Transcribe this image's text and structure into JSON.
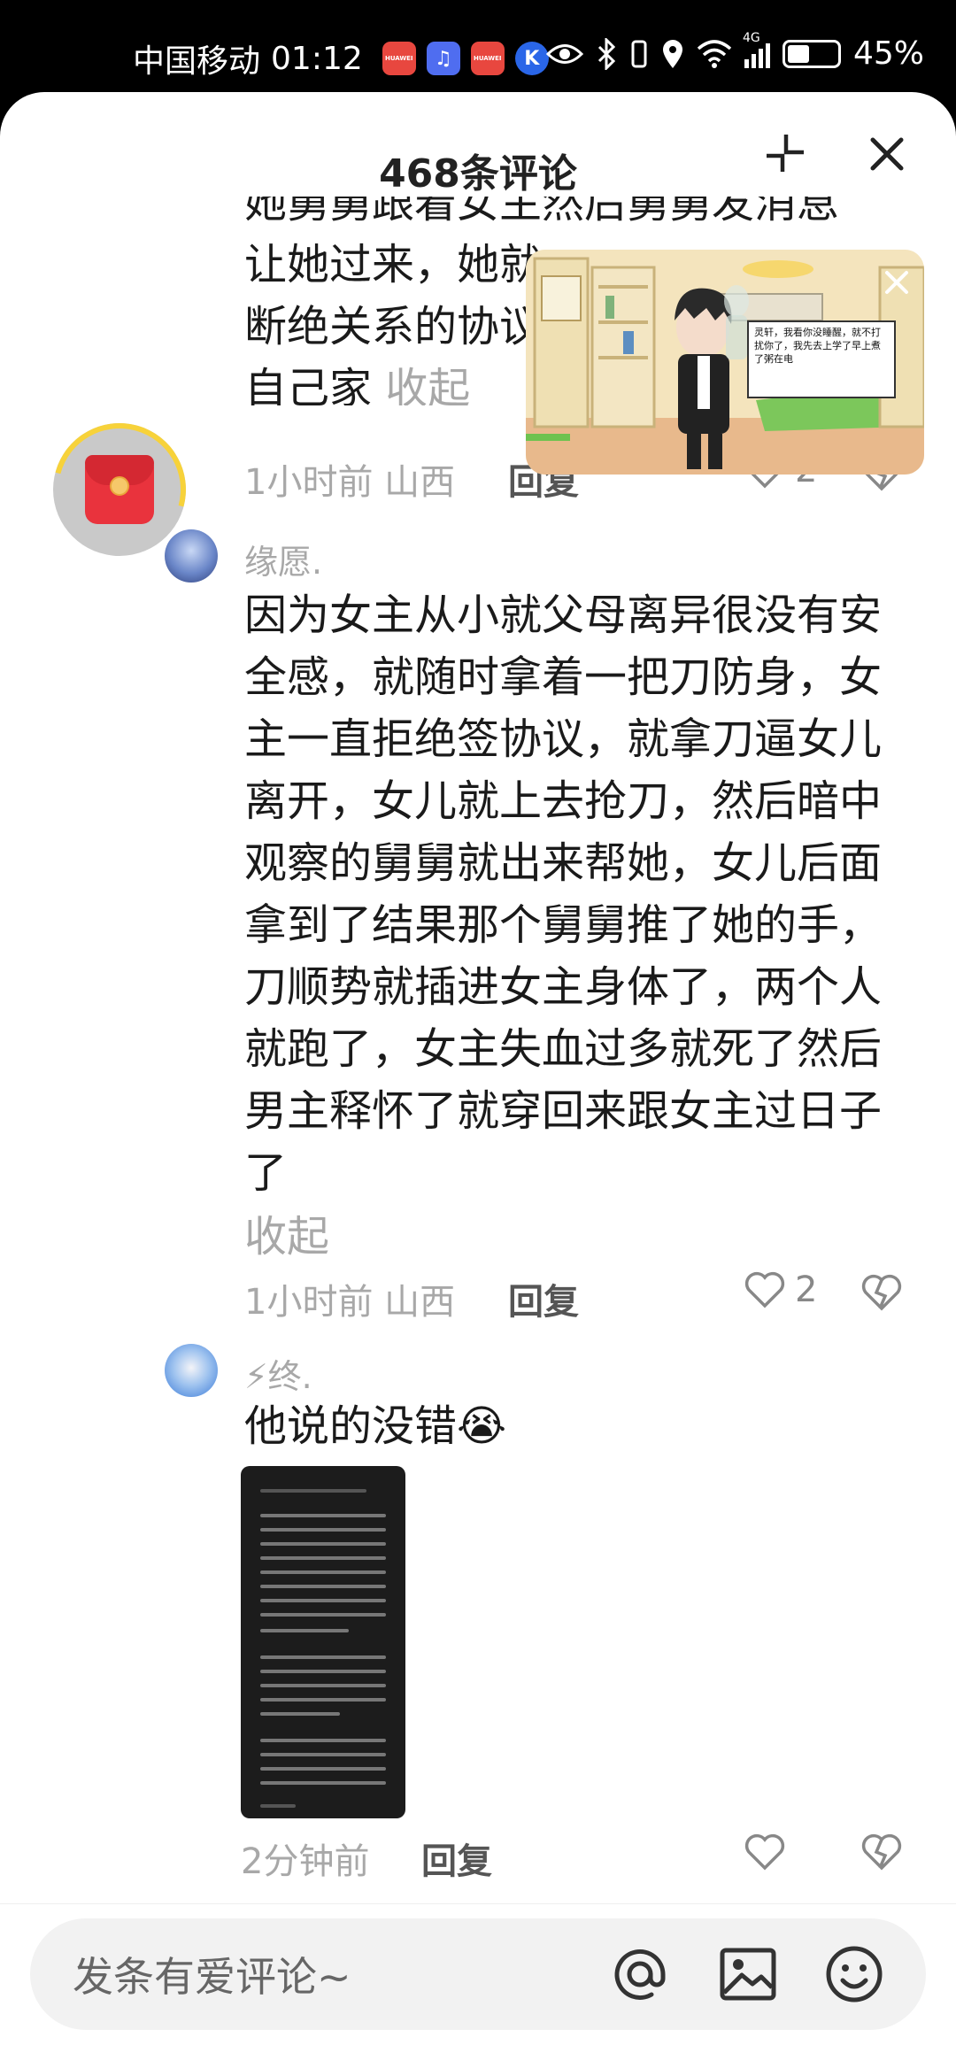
{
  "status_bar": {
    "carrier": "中国移动",
    "time": "01:12",
    "app_icons": [
      {
        "name": "huawei-icon",
        "label": "HUAWEI",
        "color": "#e8473f"
      },
      {
        "name": "music-icon",
        "label": "",
        "color": "#4f6df0"
      },
      {
        "name": "huawei-icon",
        "label": "HUAWEI",
        "color": "#e8473f"
      },
      {
        "name": "k-app-icon",
        "label": "K",
        "color": "#2a66e8"
      }
    ],
    "network": "4G",
    "battery": "45%"
  },
  "sheet": {
    "title": "468条评论"
  },
  "comments": [
    {
      "text_lines": [
        "她舅舅跟着女主然后舅舅发消息",
        "让她过来，她就",
        "断绝关系的协议",
        "自己家"
      ],
      "collapse": "收起",
      "time_location": "1小时前 山西",
      "reply": "回复",
      "likes": "2"
    },
    {
      "username": "缘愿.",
      "text": "因为女主从小就父母离异很没有安全感，就随时拿着一把刀防身，女主一直拒绝签协议，就拿刀逼女儿离开，女儿就上去抢刀，然后暗中观察的舅舅就出来帮她，女儿后面拿到了结果那个舅舅推了她的手，刀顺势就插进女主身体了，两个人就跑了，女主失血过多就死了然后男主释怀了就穿回来跟女主过日子了",
      "collapse": "收起",
      "time_location": "1小时前 山西",
      "reply": "回复",
      "likes": "2"
    },
    {
      "username": "⚡终.",
      "text": "他说的没错😭",
      "time": "2分钟前",
      "reply": "回复"
    }
  ],
  "mini_video": {
    "speech": "灵轩，我看你没睡醒，就不打扰你了，我先去上学了早上煮了粥在电"
  },
  "input": {
    "placeholder": "发条有爱评论~"
  },
  "colors": {
    "red_packet": "#e9333d",
    "progress_ring": "#f7d23a"
  }
}
